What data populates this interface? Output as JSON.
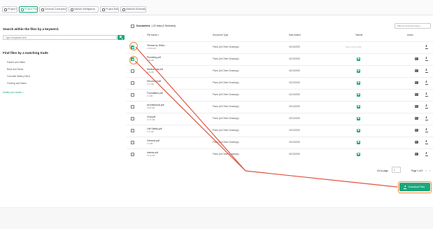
{
  "tabs": [
    {
      "label": "Project Info",
      "active": false,
      "icon": "info-icon"
    },
    {
      "label": "Project Files",
      "active": true,
      "icon": "folder-icon"
    },
    {
      "label": "General Contractors",
      "active": false,
      "icon": "users-icon"
    },
    {
      "label": "Market Intelligence",
      "active": false,
      "icon": "chart-icon"
    },
    {
      "label": "Project Bids",
      "active": false,
      "icon": "gavel-icon"
    },
    {
      "label": "Material Estimates",
      "active": false,
      "icon": "calculator-icon"
    }
  ],
  "search": {
    "title": "Search within the files by a keyword.",
    "placeholder": "Type a keyword here"
  },
  "trades": {
    "title": "Find files by a matching trade",
    "items": [
      "Pavers and Slabs",
      "Brick and Stone",
      "Concrete Walls (CMU)",
      "Flooring and Stairs"
    ],
    "more_link": "Modify your trades >"
  },
  "documents": {
    "label": "Documents",
    "count_text": "( 22 total (2 Selected)",
    "filter_placeholder": "Filter by document type (..."
  },
  "columns": {
    "file_name": "File Name ▾",
    "document_type": "Document Type",
    "date_added": "Date Added",
    "takeoff": "Takeoff",
    "action": "Action"
  },
  "rows": [
    {
      "name": "Terrace by Hilton ...",
      "size": "179.59 MB",
      "type": "Plans (All Other Drawings)",
      "date": "02/13/2020",
      "takeoff": "note",
      "takeoff_note": "Files must be PDF",
      "checked": true,
      "has_image_action": false
    },
    {
      "name": "Plumbing.pdf",
      "size": "8.36 MB",
      "type": "Plans (All Other Drawings)",
      "date": "02/13/2020",
      "takeoff": "x",
      "checked": true,
      "has_image_action": true
    },
    {
      "name": "Mechanical.pdf",
      "size": "4.29 MB",
      "type": "Plans (All Other Drawings)",
      "date": "02/13/2020",
      "takeoff": "x",
      "checked": false,
      "has_image_action": true
    },
    {
      "name": "Structural.pdf",
      "size": "8.71 MB",
      "type": "Plans (All Other Drawings)",
      "date": "02/13/2020",
      "takeoff": "x",
      "checked": false,
      "has_image_action": true
    },
    {
      "name": "Foundation.pdf",
      "size": "2.4 MB",
      "type": "Plans (All Other Drawings)",
      "date": "02/13/2020",
      "takeoff": "x",
      "checked": false,
      "has_image_action": true
    },
    {
      "name": "Architectural.pdf",
      "size": "24.84 MB",
      "type": "Plans (All Other Drawings)",
      "date": "02/13/2020",
      "takeoff": "x",
      "checked": false,
      "has_image_action": true
    },
    {
      "name": "Civil.pdf",
      "size": "41.71 MB",
      "type": "Plans (All Other Drawings)",
      "date": "02/13/2020",
      "takeoff": "x",
      "checked": false,
      "has_image_action": true
    },
    {
      "name": "Life Safety.pdf",
      "size": "2.73 MB",
      "type": "Plans (All Other Drawings)",
      "date": "02/13/2020",
      "takeoff": "x",
      "checked": false,
      "has_image_action": true
    },
    {
      "name": "General.pdf",
      "size": "4.2 MB",
      "type": "Plans (All Other Drawings)",
      "date": "02/13/2020",
      "takeoff": "x",
      "checked": false,
      "has_image_action": true
    },
    {
      "name": "Interior.pdf",
      "size": "20.39 MB",
      "type": "Plans (All Other Drawings)",
      "date": "02/13/2020",
      "takeoff": "x",
      "checked": false,
      "has_image_action": true
    }
  ],
  "pagination": {
    "goto_label": "Go to page",
    "goto_value": "1",
    "page_info": "Page 1 of 3",
    "prev": "‹",
    "next": "›"
  },
  "download_button": {
    "label": "Download Files",
    "icon": "download-icon"
  },
  "colors": {
    "accent": "#17a97c",
    "highlight": "#e8893a",
    "arrow": "#e0533c"
  }
}
